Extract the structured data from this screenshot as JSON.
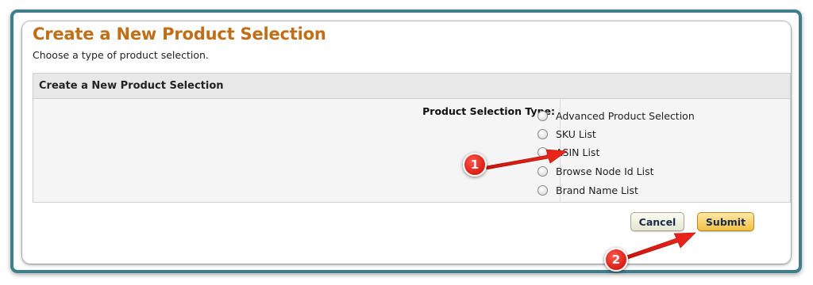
{
  "page": {
    "title": "Create a New Product Selection",
    "subtitle": "Choose a type of product selection."
  },
  "form": {
    "header": "Create a New Product Selection",
    "field_label": "Product Selection Type:",
    "options": [
      "Advanced Product Selection",
      "SKU List",
      "ASIN List",
      "Browse Node Id List",
      "Brand Name List"
    ]
  },
  "buttons": {
    "cancel": "Cancel",
    "submit": "Submit"
  },
  "callouts": {
    "step1": "1",
    "step2": "2"
  },
  "colors": {
    "title": "#c06e17",
    "frame": "#3f7f8b",
    "callout": "#e0251b"
  }
}
